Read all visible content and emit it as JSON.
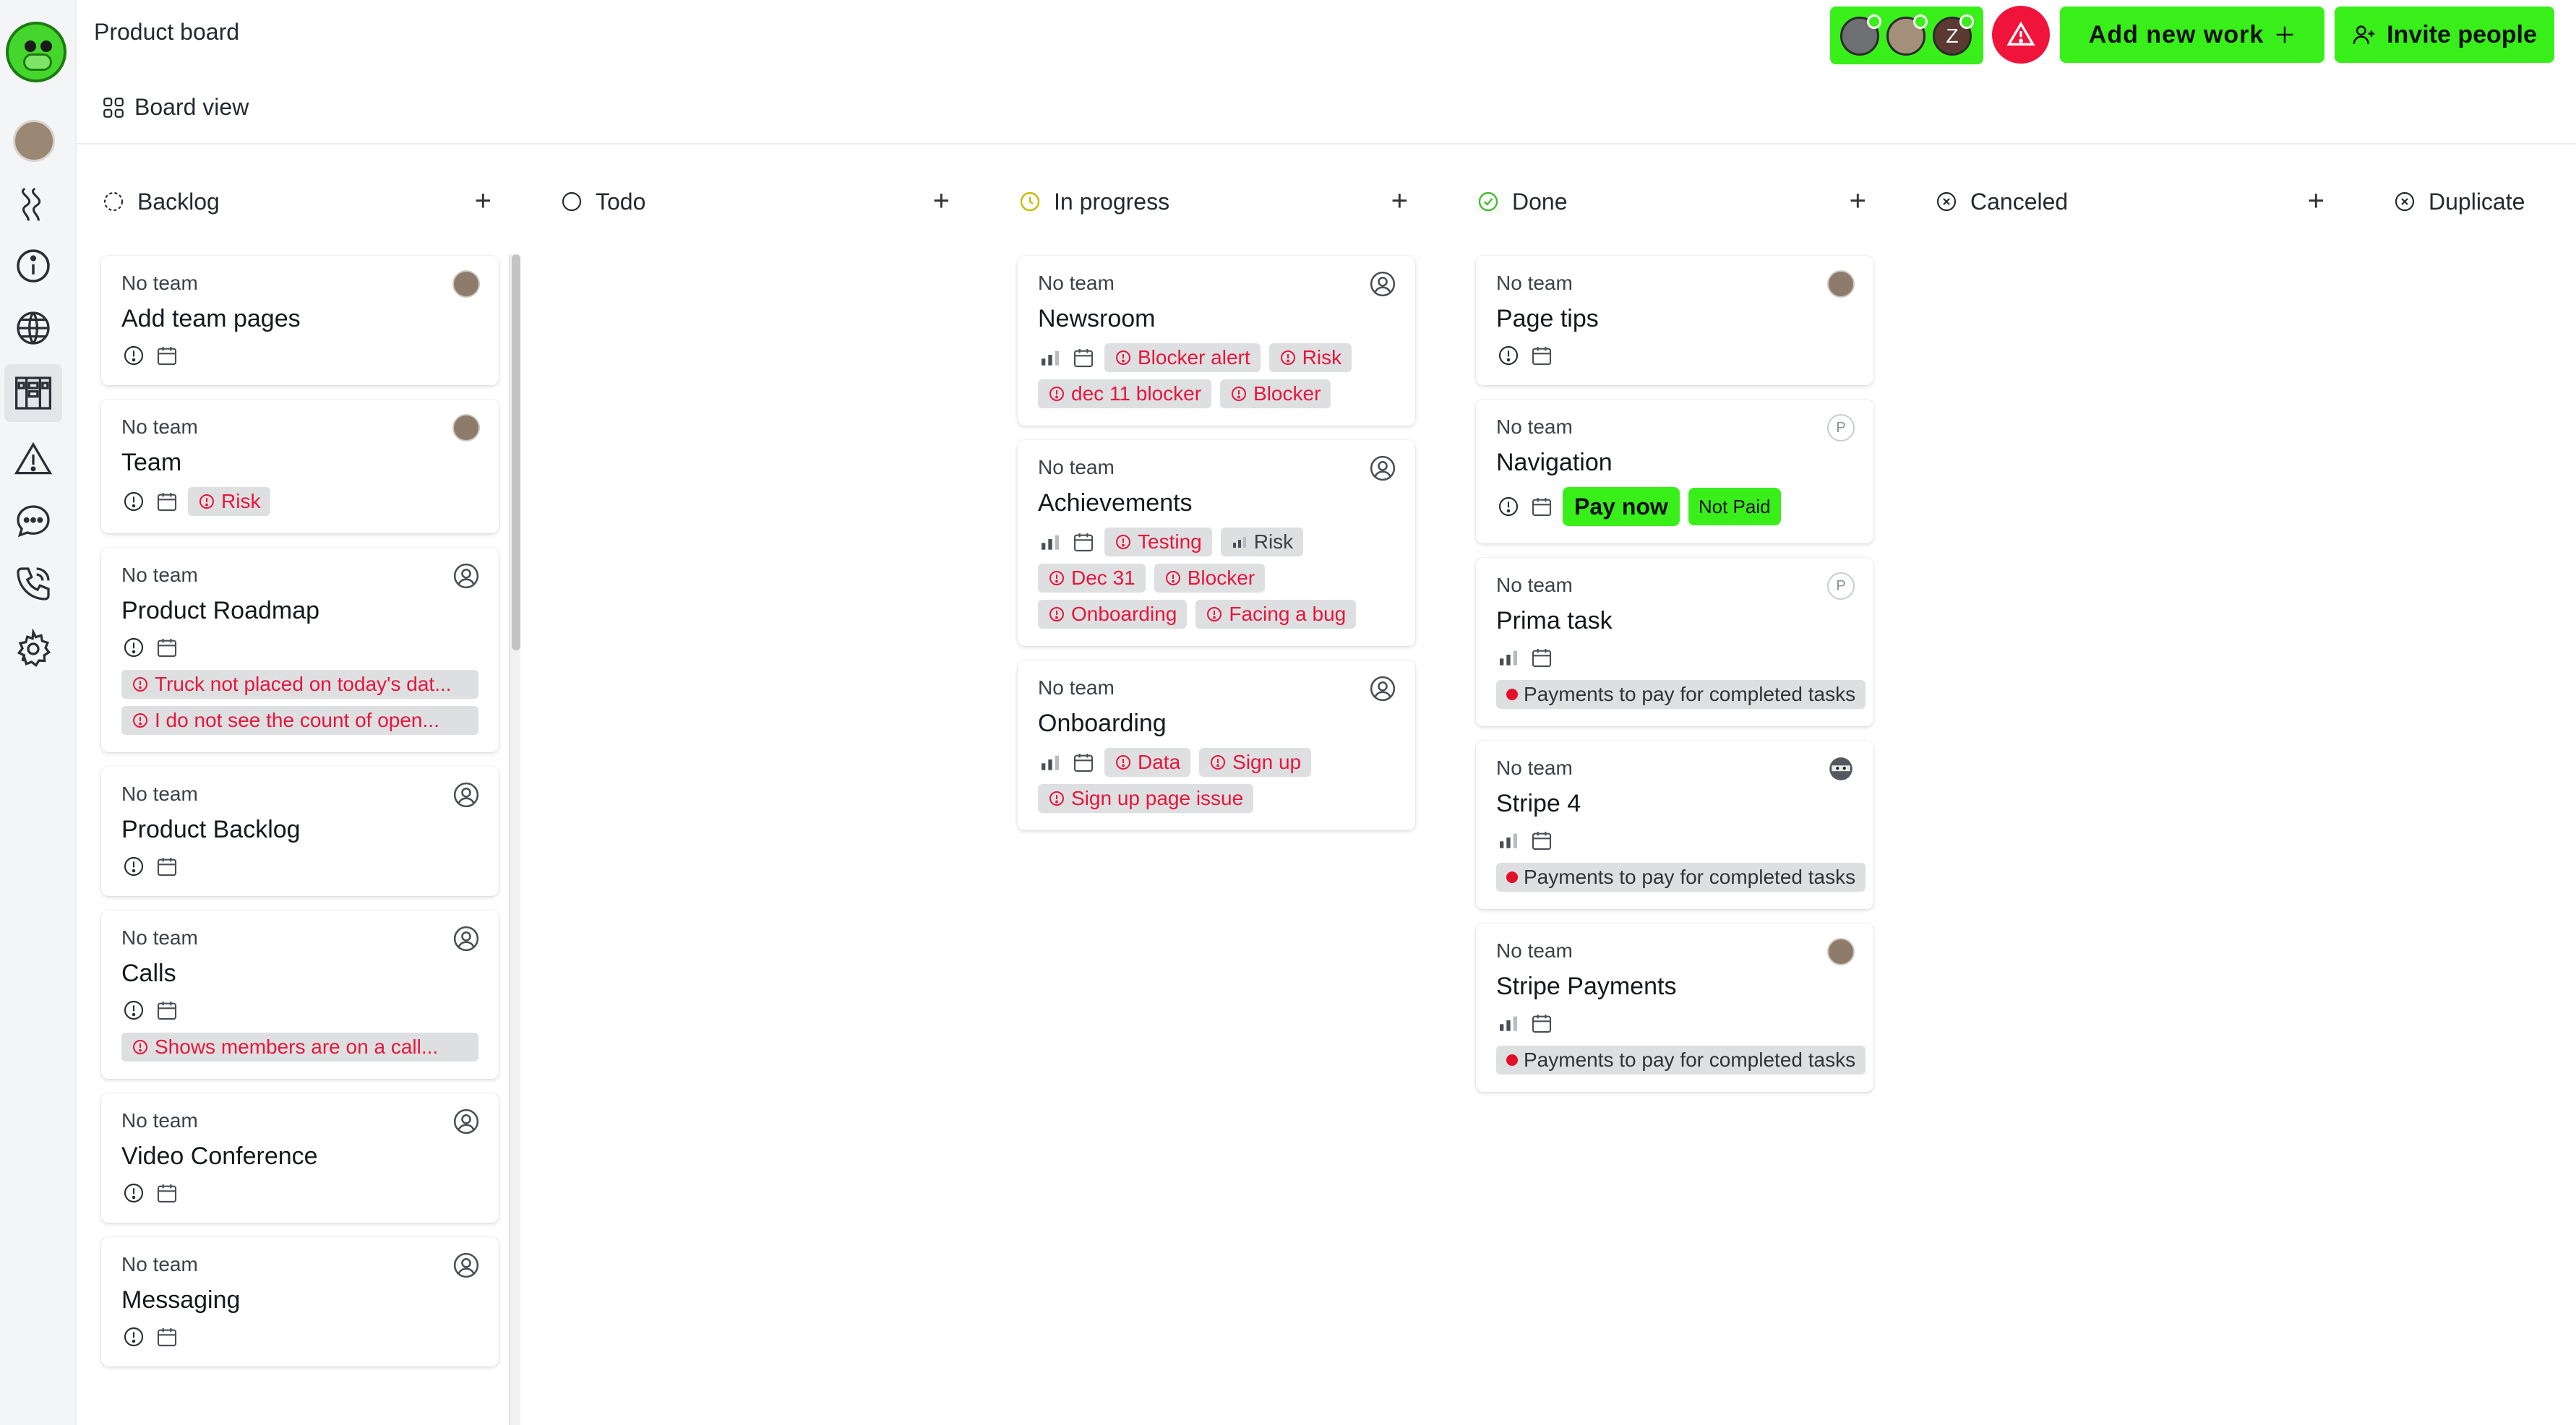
{
  "app": {
    "title": "Product board",
    "view_label": "Board view",
    "add_work_label": "Add new work",
    "invite_label": "Invite people",
    "avatar_z_letter": "Z",
    "accent_color": "#39ef1a",
    "alert_color": "#f0133a"
  },
  "sidebar": {
    "items": [
      "avatar",
      "road-icon",
      "info-icon",
      "globe-icon",
      "board-icon",
      "warning-icon",
      "chat-icon",
      "phone-icon",
      "gear-icon"
    ],
    "active": "board-icon"
  },
  "columns": [
    {
      "label": "Backlog",
      "status_icon": "dashed-circle-icon",
      "cards": [
        {
          "team": "No team",
          "title": "Add team pages",
          "assignee": "photo",
          "tags": []
        },
        {
          "team": "No team",
          "title": "Team",
          "assignee": "photo",
          "tags": [
            "Risk"
          ]
        },
        {
          "team": "No team",
          "title": "Product Roadmap",
          "assignee": "user",
          "full_tags": [
            "Truck not placed on today's dat...",
            "I do not see the count of open..."
          ]
        },
        {
          "team": "No team",
          "title": "Product Backlog",
          "assignee": "user",
          "tags": []
        },
        {
          "team": "No team",
          "title": "Calls",
          "assignee": "user",
          "full_tags": [
            "Shows members are on a call..."
          ]
        },
        {
          "team": "No team",
          "title": "Video Conference",
          "assignee": "user",
          "tags": []
        },
        {
          "team": "No team",
          "title": "Messaging",
          "assignee": "user",
          "tags": []
        }
      ]
    },
    {
      "label": "Todo",
      "status_icon": "circle-icon",
      "cards": []
    },
    {
      "label": "In progress",
      "status_icon": "clock-icon",
      "cards": [
        {
          "team": "No team",
          "title": "Newsroom",
          "assignee": "user",
          "tags": [
            "Blocker alert",
            "Risk",
            "dec 11 blocker",
            "Blocker"
          ]
        },
        {
          "team": "No team",
          "title": "Achievements",
          "assignee": "user",
          "tags": [
            "Testing",
            "Risk",
            "Dec 31",
            "Blocker",
            "Onboarding",
            "Facing a bug"
          ]
        },
        {
          "team": "No team",
          "title": "Onboarding",
          "assignee": "user",
          "tags": [
            "Data",
            "Sign up",
            "Sign up page issue"
          ]
        }
      ]
    },
    {
      "label": "Done",
      "status_icon": "check-circle-icon",
      "cards": [
        {
          "team": "No team",
          "title": "Page tips",
          "assignee": "photo",
          "tags": []
        },
        {
          "team": "No team",
          "title": "Navigation",
          "assignee": "P",
          "buttons": [
            "Pay now",
            "Not Paid"
          ]
        },
        {
          "team": "No team",
          "title": "Prima task",
          "assignee": "P",
          "payment": "Payments to pay for completed tasks"
        },
        {
          "team": "No team",
          "title": "Stripe 4",
          "assignee": "ninja",
          "payment": "Payments to pay for completed tasks"
        },
        {
          "team": "No team",
          "title": "Stripe Payments",
          "assignee": "photo",
          "payment": "Payments to pay for completed tasks"
        }
      ]
    },
    {
      "label": "Canceled",
      "status_icon": "x-circle-icon",
      "cards": []
    },
    {
      "label": "Duplicate",
      "status_icon": "x-circle-icon",
      "cards": []
    }
  ],
  "plus_symbol": "+"
}
